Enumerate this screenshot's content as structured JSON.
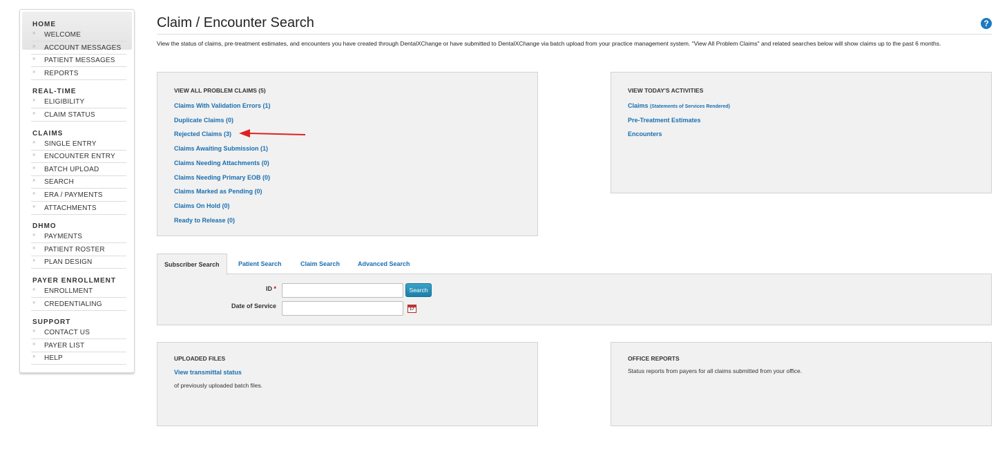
{
  "sidebar": {
    "groups": [
      {
        "title": "HOME",
        "items": [
          "WELCOME",
          "ACCOUNT MESSAGES",
          "PATIENT MESSAGES",
          "REPORTS"
        ]
      },
      {
        "title": "REAL-TIME",
        "items": [
          "ELIGIBILITY",
          "CLAIM STATUS"
        ]
      },
      {
        "title": "CLAIMS",
        "items": [
          "SINGLE ENTRY",
          "ENCOUNTER ENTRY",
          "BATCH UPLOAD",
          "SEARCH",
          "ERA / PAYMENTS",
          "ATTACHMENTS"
        ]
      },
      {
        "title": "DHMO",
        "items": [
          "PAYMENTS",
          "PATIENT ROSTER",
          "PLAN DESIGN"
        ]
      },
      {
        "title": "PAYER ENROLLMENT",
        "items": [
          "ENROLLMENT",
          "CREDENTIALING"
        ]
      },
      {
        "title": "SUPPORT",
        "items": [
          "CONTACT US",
          "PAYER LIST",
          "HELP"
        ]
      }
    ]
  },
  "header": {
    "title": "Claim / Encounter Search",
    "help_icon": "?",
    "intro": "View the status of claims, pre-treatment estimates, and encounters you have created through DentalXChange or have submitted to DentalXChange via batch upload from your practice management system. \"View All Problem Claims\" and related searches below will show claims up to the past 6 months."
  },
  "problem_claims": {
    "title": "VIEW ALL PROBLEM CLAIMS (5)",
    "links": [
      "Claims With Validation Errors (1)",
      "Duplicate Claims (0)",
      "Rejected Claims (3)",
      "Claims Awaiting Submission (1)",
      "Claims Needing Attachments (0)",
      "Claims Needing Primary EOB (0)",
      "Claims Marked as Pending (0)",
      "Claims On Hold (0)",
      "Ready to Release (0)"
    ]
  },
  "todays_activities": {
    "title": "VIEW TODAY'S ACTIVITIES",
    "claims_label": "Claims",
    "claims_note": "(Statements of Services Rendered)",
    "pre_treatment": "Pre-Treatment Estimates",
    "encounters": "Encounters"
  },
  "search_tabs": {
    "tabs": [
      "Subscriber Search",
      "Patient Search",
      "Claim Search",
      "Advanced Search"
    ],
    "active": "Subscriber Search",
    "id_label": "ID",
    "required_mark": "*",
    "id_value": "",
    "search_button": "Search",
    "dos_label": "Date of Service",
    "dos_value": "",
    "calendar_icon": "calendar-icon",
    "calendar_day": "17"
  },
  "uploaded_files": {
    "title": "UPLOADED FILES",
    "link": "View transmittal status",
    "text": "of previously uploaded batch files."
  },
  "office_reports": {
    "title": "OFFICE REPORTS",
    "text": "Status reports from payers for all claims submitted from your office."
  },
  "colors": {
    "link": "#1a6fb0",
    "panel_bg": "#f1f1f1",
    "arrow": "#e02020",
    "button": "#1c7fa8"
  }
}
